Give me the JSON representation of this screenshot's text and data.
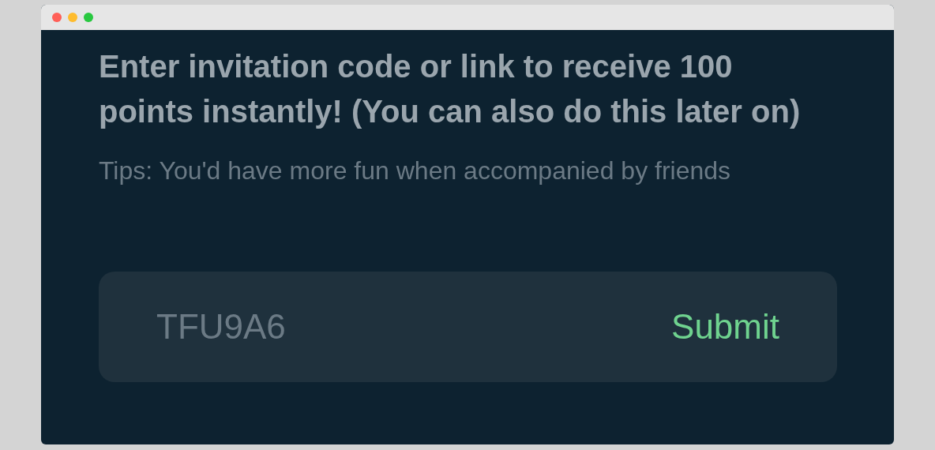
{
  "heading": "Enter invitation code or link to receive 100 points instantly! (You can also do this later on)",
  "tip": "Tips: You'd have more fun when accompanied by friends",
  "code_field": {
    "value": "TFU9A6"
  },
  "submit_button": {
    "label": "Submit"
  }
}
